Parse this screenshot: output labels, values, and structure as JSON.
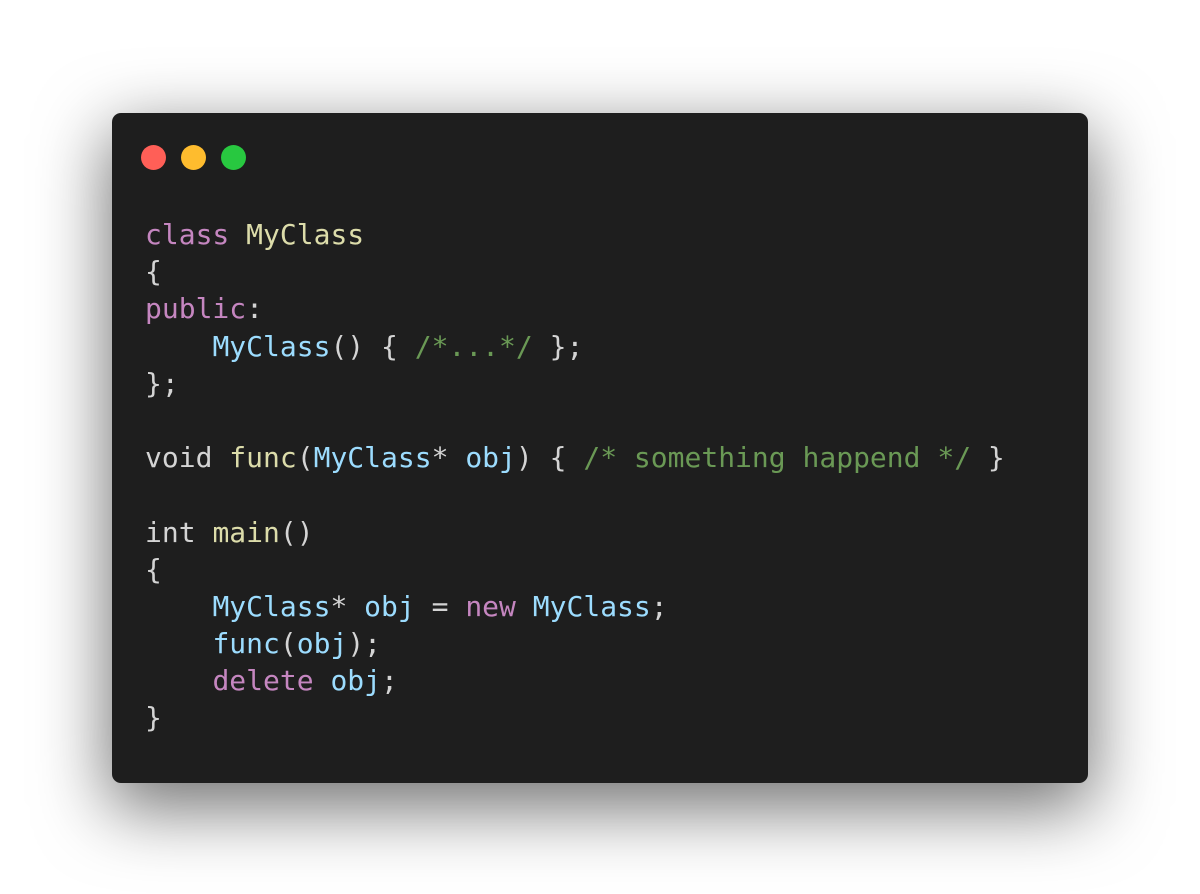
{
  "window": {
    "controls": [
      {
        "name": "close",
        "color": "#ff5f57"
      },
      {
        "name": "minimize",
        "color": "#febc2e"
      },
      {
        "name": "maximize",
        "color": "#28c840"
      }
    ]
  },
  "code_lines": [
    [
      {
        "t": "class ",
        "c": "kw"
      },
      {
        "t": "MyClass",
        "c": "type"
      }
    ],
    [
      {
        "t": "{",
        "c": "plain"
      }
    ],
    [
      {
        "t": "public",
        "c": "kw"
      },
      {
        "t": ":",
        "c": "plain"
      }
    ],
    [
      {
        "t": "    ",
        "c": "plain"
      },
      {
        "t": "MyClass",
        "c": "ident"
      },
      {
        "t": "() { ",
        "c": "plain"
      },
      {
        "t": "/*...*/",
        "c": "comment"
      },
      {
        "t": " };",
        "c": "plain"
      }
    ],
    [
      {
        "t": "};",
        "c": "plain"
      }
    ],
    [],
    [
      {
        "t": "void ",
        "c": "plain"
      },
      {
        "t": "func",
        "c": "fn"
      },
      {
        "t": "(",
        "c": "plain"
      },
      {
        "t": "MyClass",
        "c": "ident"
      },
      {
        "t": "* ",
        "c": "plain"
      },
      {
        "t": "obj",
        "c": "ident"
      },
      {
        "t": ") { ",
        "c": "plain"
      },
      {
        "t": "/* something happend */",
        "c": "comment"
      },
      {
        "t": " }",
        "c": "plain"
      }
    ],
    [],
    [
      {
        "t": "int ",
        "c": "plain"
      },
      {
        "t": "main",
        "c": "fn"
      },
      {
        "t": "()",
        "c": "plain"
      }
    ],
    [
      {
        "t": "{",
        "c": "plain"
      }
    ],
    [
      {
        "t": "    ",
        "c": "plain"
      },
      {
        "t": "MyClass",
        "c": "ident"
      },
      {
        "t": "* ",
        "c": "plain"
      },
      {
        "t": "obj",
        "c": "ident"
      },
      {
        "t": " = ",
        "c": "plain"
      },
      {
        "t": "new ",
        "c": "kw"
      },
      {
        "t": "MyClass",
        "c": "ident"
      },
      {
        "t": ";",
        "c": "plain"
      }
    ],
    [
      {
        "t": "    ",
        "c": "plain"
      },
      {
        "t": "func",
        "c": "ident"
      },
      {
        "t": "(",
        "c": "plain"
      },
      {
        "t": "obj",
        "c": "ident"
      },
      {
        "t": ");",
        "c": "plain"
      }
    ],
    [
      {
        "t": "    ",
        "c": "plain"
      },
      {
        "t": "delete ",
        "c": "kw"
      },
      {
        "t": "obj",
        "c": "ident"
      },
      {
        "t": ";",
        "c": "plain"
      }
    ],
    [
      {
        "t": "}",
        "c": "plain"
      }
    ]
  ]
}
